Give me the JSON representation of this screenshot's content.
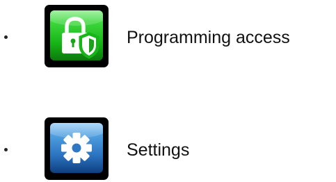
{
  "menu": {
    "items": [
      {
        "id": "programming-access",
        "label": "Programming access",
        "icon": "lock-shield-icon",
        "tile_color": "#22c322"
      },
      {
        "id": "settings",
        "label": "Settings",
        "icon": "gear-icon",
        "tile_color": "#2e78c4"
      }
    ]
  }
}
